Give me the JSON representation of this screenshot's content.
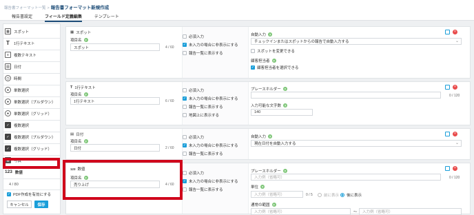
{
  "breadcrumb": {
    "parent": "報告書フォーマット一覧",
    "separator": ">",
    "current": "報告書フォーマット新規作成"
  },
  "tabs": [
    {
      "label": "報告書設定",
      "active": false
    },
    {
      "label": "フィールド定義編集",
      "active": true
    },
    {
      "label": "テンプレート",
      "active": false
    }
  ],
  "sidebar": {
    "items": [
      {
        "label": "スポット",
        "icon": "building-icon"
      },
      {
        "label": "1行テキスト",
        "icon": "text-icon"
      },
      {
        "label": "複数テキスト",
        "icon": "paragraph-icon"
      },
      {
        "label": "日付",
        "icon": "calendar-icon"
      },
      {
        "label": "時間",
        "icon": "clock-icon"
      },
      {
        "label": "単数選択",
        "icon": "radio-icon"
      },
      {
        "label": "単数選択（プルダウン）",
        "icon": "radio-icon"
      },
      {
        "label": "単数選択（グリッド）",
        "icon": "radio-icon"
      },
      {
        "label": "複数選択",
        "icon": "checkbox-icon"
      },
      {
        "label": "複数選択（プルダウン）",
        "icon": "checkbox-icon"
      },
      {
        "label": "複数選択（グリッド）",
        "icon": "checkbox-icon"
      },
      {
        "label": "写真",
        "icon": "camera-icon"
      },
      {
        "label": "数値",
        "icon": "number-icon",
        "icon_text": "123"
      }
    ],
    "counter": "4 / 80",
    "pdf_label": "PDF作成を有効にする",
    "cancel_label": "キャンセル",
    "save_label": "保存"
  },
  "cards": [
    {
      "title": "スポット",
      "name_label": "項目名",
      "name_value": "スポット",
      "count": "4 / 60",
      "opt_required": "必須入力",
      "opt_hide": "未入力の場合に非表示にする",
      "opt_list": "報告一覧に表示する",
      "auto_label": "自動入力",
      "auto_value": "チェックインまたはスポットからの報告で自動入力する",
      "change_spot": "スポットを変更できる",
      "customer_label": "顧客担当者",
      "customer_select": "顧客担当者を選択できる"
    },
    {
      "title": "1行テキスト",
      "name_label": "項目名",
      "name_value": "1行テキスト",
      "count": "6 / 60",
      "opt_required": "必須入力",
      "opt_hide": "未入力の場合に非表示にする",
      "opt_list": "報告一覧に表示する",
      "opt_map": "地図上に表示する",
      "placeholder_label": "プレースホルダー",
      "placeholder_count": "0 / 120",
      "maxlen_label": "入力可能な文字数",
      "maxlen_value": "140"
    },
    {
      "title": "日付",
      "name_label": "項目名",
      "name_value": "日付",
      "count": "2 / 60",
      "opt_required": "必須入力",
      "opt_hide": "未入力の場合に非表示にする",
      "opt_list": "報告一覧に表示する",
      "auto_label": "自動入力",
      "auto_value": "現在日付を自動入力する"
    },
    {
      "title": "数値",
      "name_label": "項目名",
      "name_value": "売り上げ",
      "count": "4 / 60",
      "opt_required": "必須入力",
      "opt_hide": "未入力の場合に非表示にする",
      "opt_list": "報告一覧に表示する",
      "placeholder_label": "プレースホルダー",
      "placeholder_hint": "入力例（省略可）",
      "placeholder_count": "0 / 120",
      "unit_label": "単位",
      "unit_hint": "入力例（省略可）",
      "unit_count": "0 / 5",
      "unit_before": "前に表示",
      "unit_after": "後に表示",
      "range_label": "通常の範囲",
      "range_min_hint": "入力例（省略可）",
      "range_sep": "〜",
      "range_max_hint": "入力例（省略可）"
    }
  ],
  "colors": {
    "accent": "#1a9ed9",
    "highlight": "#d0021b",
    "title": "#1f4e79"
  }
}
